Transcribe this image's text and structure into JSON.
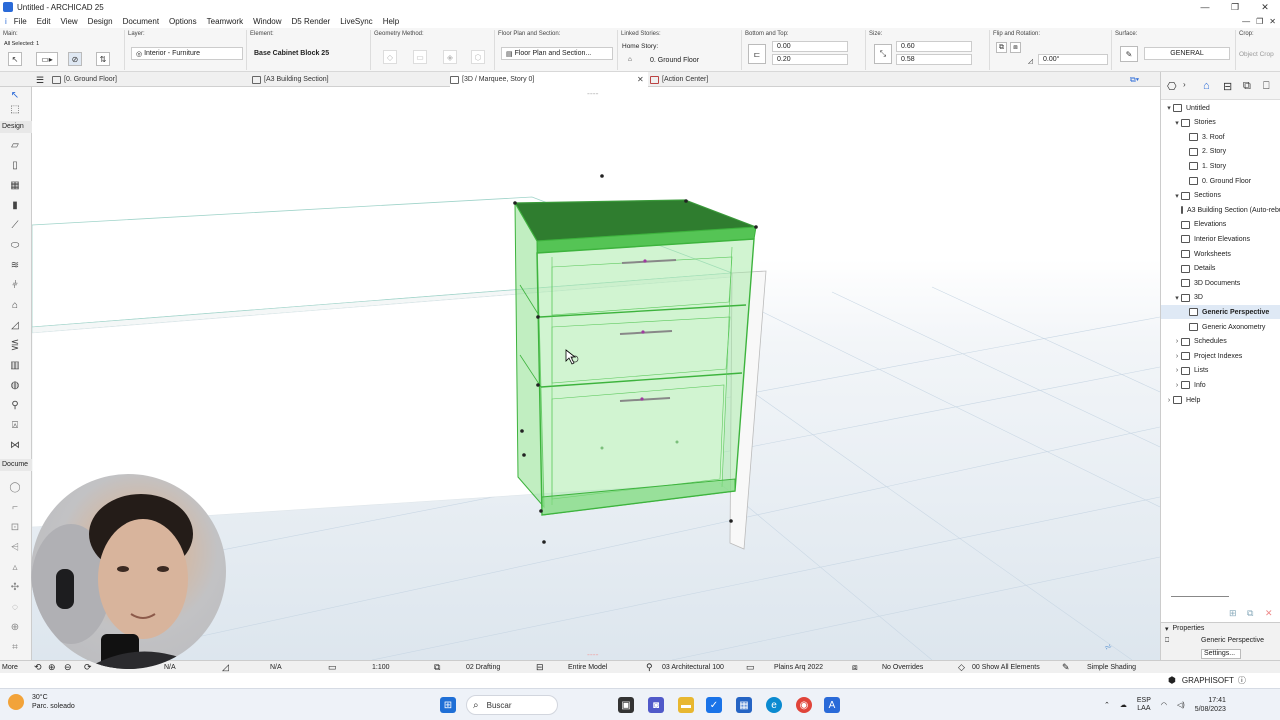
{
  "window": {
    "title": "Untitled - ARCHICAD 25"
  },
  "menu": [
    "File",
    "Edit",
    "View",
    "Design",
    "Document",
    "Options",
    "Teamwork",
    "Window",
    "D5 Render",
    "LiveSync",
    "Help"
  ],
  "menu_first": "i",
  "infobox": {
    "main_label": "Main:",
    "all_selected": "All Selected: 1",
    "layer_label": "Layer:",
    "layer_value": "Interior - Furniture",
    "element_label": "Element:",
    "element_value": "Base Cabinet Block 25",
    "geometry_label": "Geometry Method:",
    "floorplan_label": "Floor Plan and Section:",
    "floorplan_value": "Floor Plan and Section...",
    "linked_label": "Linked Stories:",
    "home_story_label": "Home Story:",
    "home_story_value": "0. Ground Floor",
    "bottom_top_label": "Bottom and Top:",
    "top_value": "0.00",
    "bottom_value": "0.20",
    "size_label": "Size:",
    "size_x": "0.60",
    "size_y": "0.58",
    "flip_label": "Flip and Rotation:",
    "rotation_value": "0.00°",
    "surface_label": "Surface:",
    "surface_value": "GENERAL",
    "crop_label": "Crop:",
    "crop_value": "Object Crop"
  },
  "tabs": [
    {
      "label": "[0. Ground Floor]"
    },
    {
      "label": "[A3 Building Section]"
    },
    {
      "label": "[3D / Marquee, Story 0]"
    },
    {
      "label": "[Action Center]"
    }
  ],
  "toolbox": {
    "design": "Design",
    "document": "Docume",
    "more": "More"
  },
  "navigator": {
    "items": [
      {
        "label": "Untitled",
        "indent": 0,
        "twist": "▾"
      },
      {
        "label": "Stories",
        "indent": 1,
        "twist": "▾"
      },
      {
        "label": "3. Roof",
        "indent": 2,
        "twist": ""
      },
      {
        "label": "2. Story",
        "indent": 2,
        "twist": ""
      },
      {
        "label": "1. Story",
        "indent": 2,
        "twist": ""
      },
      {
        "label": "0. Ground Floor",
        "indent": 2,
        "twist": ""
      },
      {
        "label": "Sections",
        "indent": 1,
        "twist": "▾"
      },
      {
        "label": "A3 Building Section (Auto-rebuild Model)",
        "indent": 2,
        "twist": ""
      },
      {
        "label": "Elevations",
        "indent": 1,
        "twist": ""
      },
      {
        "label": "Interior Elevations",
        "indent": 1,
        "twist": ""
      },
      {
        "label": "Worksheets",
        "indent": 1,
        "twist": ""
      },
      {
        "label": "Details",
        "indent": 1,
        "twist": ""
      },
      {
        "label": "3D Documents",
        "indent": 1,
        "twist": ""
      },
      {
        "label": "3D",
        "indent": 1,
        "twist": "▾"
      },
      {
        "label": "Generic Perspective",
        "indent": 2,
        "twist": "",
        "selected": true
      },
      {
        "label": "Generic Axonometry",
        "indent": 2,
        "twist": ""
      },
      {
        "label": "Schedules",
        "indent": 1,
        "twist": "›"
      },
      {
        "label": "Project Indexes",
        "indent": 1,
        "twist": "›"
      },
      {
        "label": "Lists",
        "indent": 1,
        "twist": "›"
      },
      {
        "label": "Info",
        "indent": 1,
        "twist": "›"
      },
      {
        "label": "Help",
        "indent": 0,
        "twist": "›"
      }
    ],
    "properties_label": "Properties",
    "properties_value": "Generic Perspective",
    "settings_label": "Settings..."
  },
  "statusbar": {
    "na1": "N/A",
    "na2": "N/A",
    "scale": "1:100",
    "drafting": "02 Drafting",
    "model": "Entire Model",
    "arch": "03 Architectural 100",
    "plans": "Plains Arq 2022",
    "overrides": "No Overrides",
    "show": "00 Show All Elements",
    "shading": "Simple Shading"
  },
  "graphisoft": "GRAPHISOFT",
  "taskbar": {
    "temp": "30°C",
    "weather": "Parc. soleado",
    "search": "Buscar",
    "lang1": "ESP",
    "lang2": "LAA",
    "time": "17:41",
    "date": "5/08/2023"
  }
}
